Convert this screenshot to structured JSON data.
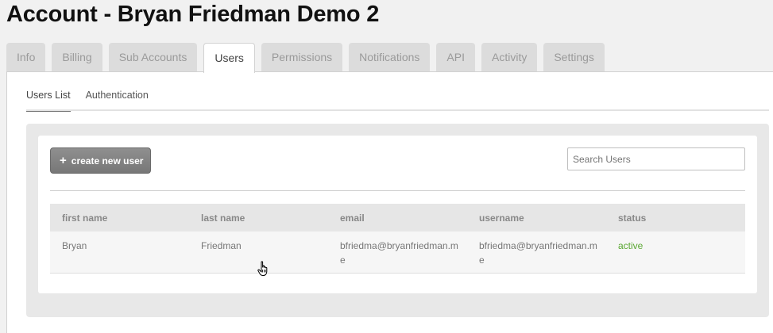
{
  "page": {
    "title": "Account - Bryan Friedman Demo 2"
  },
  "tabs": [
    {
      "label": "Info",
      "active": false
    },
    {
      "label": "Billing",
      "active": false
    },
    {
      "label": "Sub Accounts",
      "active": false
    },
    {
      "label": "Users",
      "active": true
    },
    {
      "label": "Permissions",
      "active": false
    },
    {
      "label": "Notifications",
      "active": false
    },
    {
      "label": "API",
      "active": false
    },
    {
      "label": "Activity",
      "active": false
    },
    {
      "label": "Settings",
      "active": false
    }
  ],
  "subtabs": [
    {
      "label": "Users List",
      "active": true
    },
    {
      "label": "Authentication",
      "active": false
    }
  ],
  "toolbar": {
    "create_label": "create new user",
    "create_icon": "plus-icon",
    "search_placeholder": "Search Users"
  },
  "table": {
    "columns": [
      "first name",
      "last name",
      "email",
      "username",
      "status"
    ],
    "rows": [
      {
        "first_name": "Bryan",
        "last_name": "Friedman",
        "email": "bfriedma@bryanfriedman.me",
        "username": "bfriedma@bryanfriedman.me",
        "status": "active"
      }
    ]
  },
  "colors": {
    "status_active": "#5aa732",
    "button": "#808080"
  }
}
